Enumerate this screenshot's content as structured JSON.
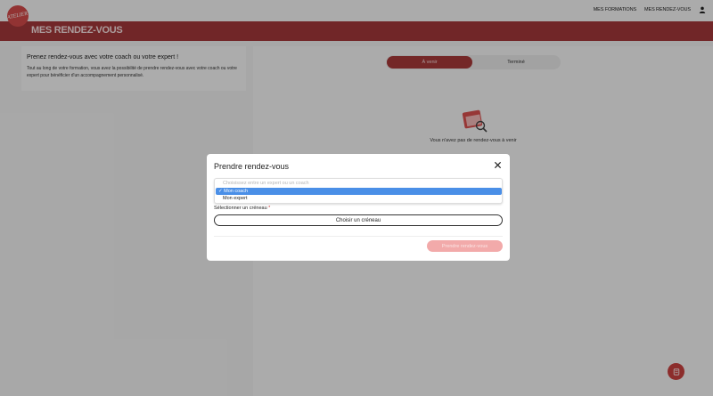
{
  "header": {
    "logo_text": "ATELIER",
    "nav": {
      "formations": "MES FORMATIONS",
      "rendez_vous": "MES RENDEZ-VOUS"
    }
  },
  "banner": {
    "title": "MES RENDEZ-VOUS"
  },
  "panel": {
    "title": "Prenez rendez-vous avec votre coach ou votre expert !",
    "text": "Tout au long de votre formation, vous avez la possibilité de prendre rendez-vous avec votre coach ou votre expert pour bénéficier d'un accompagnement personnalisé."
  },
  "tabs": {
    "upcoming": "À venir",
    "done": "Terminé"
  },
  "empty_state": {
    "text": "Vous n'avez pas de rendez-vous à venir"
  },
  "modal": {
    "title": "Prendre rendez-vous",
    "dropdown": {
      "placeholder": "Choisissez entre un expert ou un coach",
      "selected": "✓ Mon coach",
      "other": "Mon expert"
    },
    "slot_label": "Sélectionner un créneau",
    "slot_required": "*",
    "slot_button": "Choisir un créneau",
    "submit": "Prendre rendez-vous"
  },
  "colors": {
    "brand": "#a3373a",
    "accent": "#c9413f",
    "selection": "#4a8fe7"
  }
}
